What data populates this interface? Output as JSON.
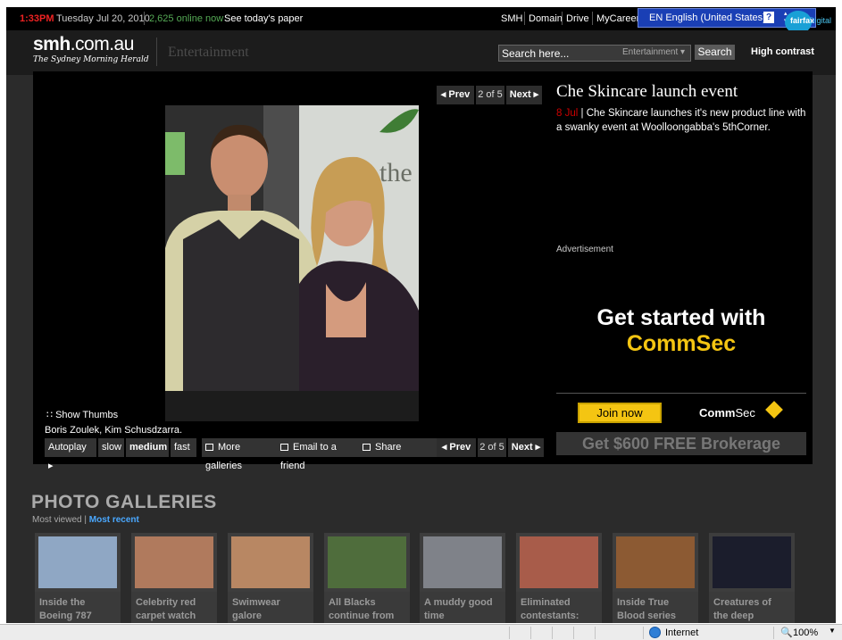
{
  "topbar": {
    "time": "1:33PM",
    "date": "Tuesday Jul 20, 2010",
    "online": "2,625 online now",
    "paper_link": "See today's paper",
    "links": [
      "SMH",
      "Domain",
      "Drive",
      "MyCareer"
    ],
    "language": "EN English (United States)",
    "help": "?",
    "fairfax": "fairfax",
    "digital": "Digital"
  },
  "header": {
    "logo_bold": "smh",
    "logo_rest": ".com.au",
    "logo_sub": "The Sydney Morning Herald",
    "section": "Entertainment",
    "search_placeholder": "Search here...",
    "search_scope": "Entertainment",
    "search_button": "Search",
    "high_contrast": "High contrast"
  },
  "gallery": {
    "prev_label": "◂ Prev",
    "counter": "2 of 5",
    "next_label": "Next ▸",
    "show_thumbs": "Show Thumbs",
    "caption": "Boris Zoulek, Kim Schusdzarra.",
    "controls": {
      "autoplay": "Autoplay ▸",
      "slow": "slow",
      "medium": "medium",
      "fast": "fast",
      "more_galleries": "More galleries",
      "email": "Email to a friend",
      "share": "Share"
    }
  },
  "article": {
    "title": "Che Skincare launch event",
    "date": "8 Jul",
    "description": "Che Skincare launches it's new product line with a swanky event at Woolloongabba's 5thCorner."
  },
  "ad": {
    "label": "Advertisement",
    "line1": "Get started with",
    "line2": "CommSec",
    "join": "Join now",
    "brand_bold": "Comm",
    "brand_rest": "Sec",
    "offer": "Get $600 FREE Brokerage"
  },
  "photo_galleries": {
    "title": "PHOTO GALLERIES",
    "most_viewed": "Most viewed",
    "separator": "|",
    "most_recent": "Most recent",
    "items": [
      {
        "line1": "Inside the",
        "line2": "Boeing 787",
        "color": "#8fa7c4"
      },
      {
        "line1": "Celebrity red",
        "line2": "carpet watch",
        "color": "#b07a5d"
      },
      {
        "line1": "Swimwear",
        "line2": "galore",
        "color": "#b88763"
      },
      {
        "line1": "All Blacks",
        "line2": "continue from",
        "color": "#4f6d3c"
      },
      {
        "line1": "A muddy good",
        "line2": "time",
        "color": "#7f8289"
      },
      {
        "line1": "Eliminated",
        "line2": "contestants:",
        "color": "#a85c4a"
      },
      {
        "line1": "Inside True",
        "line2": "Blood series",
        "color": "#8c5a33"
      },
      {
        "line1": "Creatures of",
        "line2": "the deep",
        "color": "#1b1d2c"
      }
    ]
  },
  "statusbar": {
    "zone": "Internet",
    "zoom": "100%"
  }
}
